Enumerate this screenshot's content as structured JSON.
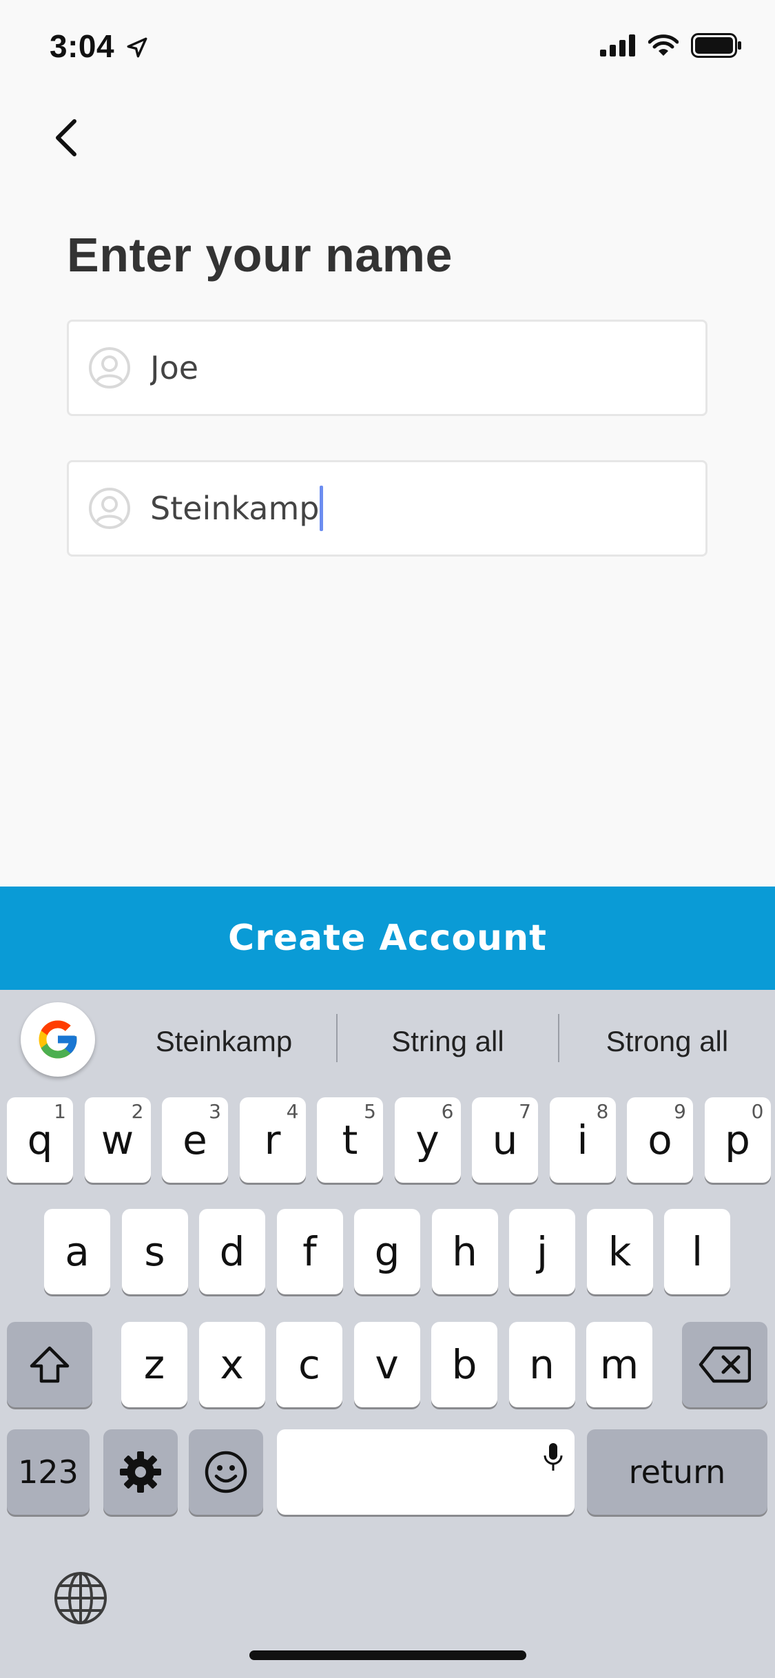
{
  "status": {
    "time": "3:04"
  },
  "page": {
    "title": "Enter your name"
  },
  "fields": {
    "first_name_value": "Joe",
    "last_name_value": "Steinkamp"
  },
  "create_button": {
    "label": "Create Account"
  },
  "keyboard": {
    "suggestions": [
      "Steinkamp",
      "String all",
      "Strong all"
    ],
    "row1": [
      {
        "k": "q",
        "h": "1"
      },
      {
        "k": "w",
        "h": "2"
      },
      {
        "k": "e",
        "h": "3"
      },
      {
        "k": "r",
        "h": "4"
      },
      {
        "k": "t",
        "h": "5"
      },
      {
        "k": "y",
        "h": "6"
      },
      {
        "k": "u",
        "h": "7"
      },
      {
        "k": "i",
        "h": "8"
      },
      {
        "k": "o",
        "h": "9"
      },
      {
        "k": "p",
        "h": "0"
      }
    ],
    "row2": [
      "a",
      "s",
      "d",
      "f",
      "g",
      "h",
      "j",
      "k",
      "l"
    ],
    "row3": [
      "z",
      "x",
      "c",
      "v",
      "b",
      "n",
      "m"
    ],
    "numbers_label": "123",
    "return_label": "return"
  },
  "colors": {
    "accent": "#0a9bd6",
    "caret": "#6c8df0",
    "keyboard_bg": "#d1d4db"
  },
  "icons": [
    "location-arrow-icon",
    "signal-icon",
    "wifi-icon",
    "battery-icon",
    "back-chevron-icon",
    "person-icon",
    "google-g-icon",
    "shift-icon",
    "delete-icon",
    "gear-icon",
    "emoji-icon",
    "mic-icon",
    "globe-icon"
  ]
}
